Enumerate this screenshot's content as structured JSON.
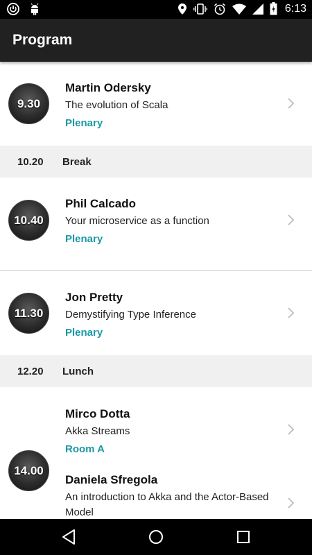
{
  "status_bar": {
    "time": "6:13",
    "icons_left": [
      "power-icon",
      "android-icon"
    ],
    "icons_right": [
      "location-icon",
      "vibrate-icon",
      "alarm-icon",
      "wifi-icon",
      "signal-icon",
      "battery-icon"
    ]
  },
  "app_bar": {
    "title": "Program"
  },
  "schedule": {
    "slot1": {
      "time": "9.30",
      "speaker": "Martin Odersky",
      "title": "The evolution of Scala",
      "track": "Plenary"
    },
    "break1": {
      "time": "10.20",
      "label": "Break"
    },
    "slot2": {
      "time": "10.40",
      "speaker": "Phil Calcado",
      "title": "Your microservice as a function",
      "track": "Plenary"
    },
    "slot3": {
      "time": "11.30",
      "speaker": "Jon Pretty",
      "title": "Demystifying Type Inference",
      "track": "Plenary"
    },
    "break2": {
      "time": "12.20",
      "label": "Lunch"
    },
    "slot4": {
      "time": "14.00",
      "talk1": {
        "speaker": "Mirco Dotta",
        "title": "Akka Streams",
        "track": "Room A"
      },
      "talk2": {
        "speaker": "Daniela Sfregola",
        "title": "An introduction to Akka and the Actor-Based Model"
      }
    }
  },
  "colors": {
    "accent": "#1a9aa6",
    "app_bar": "#212121",
    "status_bar": "#000000",
    "break_bg": "#f0f0f0"
  },
  "nav_bar": {
    "icons": [
      "back-icon",
      "home-icon",
      "recents-icon"
    ]
  }
}
